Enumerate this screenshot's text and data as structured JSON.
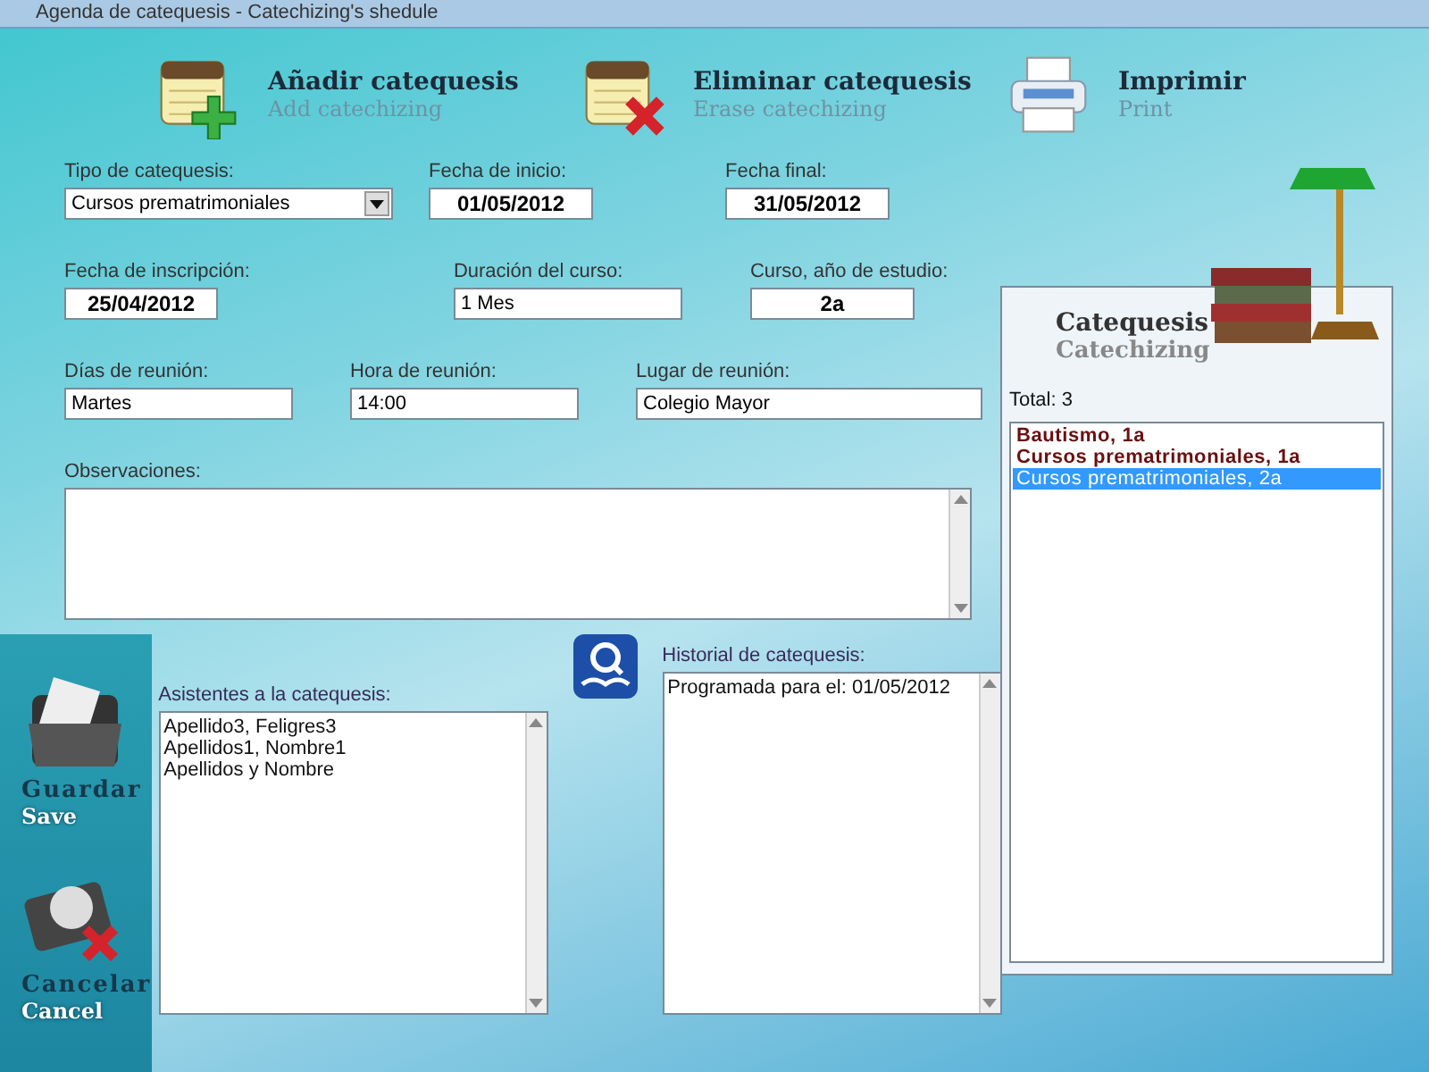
{
  "window": {
    "title": "Agenda de catequesis - Catechizing's shedule"
  },
  "toolbar": [
    {
      "kind": "add",
      "label": "Añadir catequesis",
      "sublabel": "Add catechizing"
    },
    {
      "kind": "erase",
      "label": "Eliminar catequesis",
      "sublabel": "Erase catechizing"
    },
    {
      "kind": "print",
      "label": "Imprimir",
      "sublabel": "Print"
    }
  ],
  "form_rows": [
    [
      {
        "kind": "combo",
        "label": "Tipo de catequesis:",
        "value": "Cursos prematrimoniales"
      },
      {
        "kind": "date",
        "label": "Fecha de inicio:",
        "value": "01/05/2012"
      },
      {
        "kind": "date",
        "label": "Fecha final:",
        "value": "31/05/2012"
      }
    ],
    [
      {
        "kind": "date",
        "label": "Fecha de inscripción:",
        "value": "25/04/2012"
      },
      {
        "kind": "text",
        "label": "Duración del curso:",
        "value": "1 Mes"
      },
      {
        "kind": "date",
        "label": "Curso, año de estudio:",
        "value": "2a"
      }
    ],
    [
      {
        "kind": "text",
        "label": "Días de reunión:",
        "value": "Martes"
      },
      {
        "kind": "text",
        "label": "Hora de reunión:",
        "value": "14:00"
      },
      {
        "kind": "text",
        "label": "Lugar de reunión:",
        "value": "Colegio Mayor"
      }
    ]
  ],
  "observations": {
    "label": "Observaciones:"
  },
  "actions": [
    {
      "kind": "save",
      "label": "Guardar",
      "sublabel": "Save"
    },
    {
      "kind": "cancel",
      "label": "Cancelar",
      "sublabel": "Cancel"
    }
  ],
  "attendees": {
    "label": "Asistentes a la catequesis:",
    "items": [
      "Apellido3, Feligres3",
      "Apellidos1, Nombre1",
      "Apellidos y Nombre"
    ]
  },
  "history": {
    "label": "Historial de catequesis:",
    "items": [
      "Programada para el: 01/05/2012"
    ]
  },
  "catechesis_panel": {
    "title": "Catequesis",
    "subtitle": "Catechizing",
    "total": "Total: 3",
    "items": [
      {
        "label": "Bautismo, 1a",
        "selected": false
      },
      {
        "label": "Cursos prematrimoniales, 1a",
        "selected": false
      },
      {
        "label": "Cursos prematrimoniales, 2a",
        "selected": true
      }
    ]
  }
}
